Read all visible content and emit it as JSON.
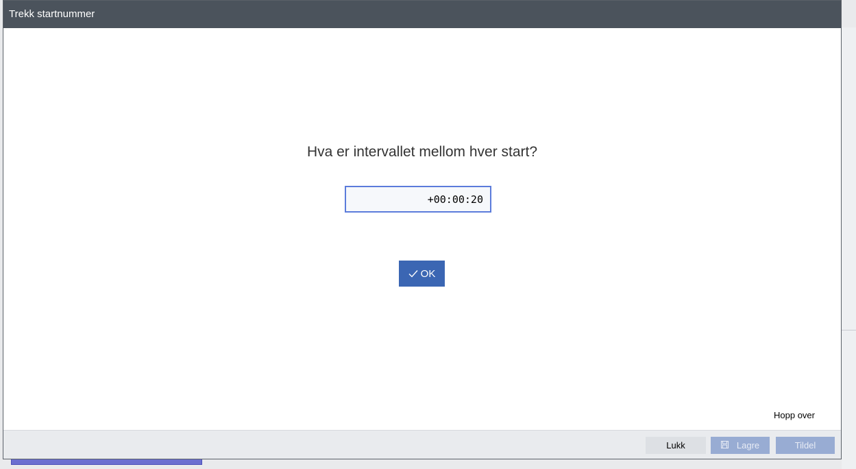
{
  "dialog": {
    "title": "Trekk startnummer",
    "question": "Hva er intervallet mellom hver start?",
    "interval_value": "+00:00:20",
    "ok_label": "OK",
    "skip_label": "Hopp over"
  },
  "footer": {
    "close_label": "Lukk",
    "save_label": "Lagre",
    "assign_label": "Tildel"
  },
  "icons": {
    "ok": "checkmark-icon",
    "save": "save-icon"
  },
  "colors": {
    "titlebar": "#4b535c",
    "accent": "#3b66b3",
    "disabled_button": "#98acd3",
    "input_border": "#5b7bdb"
  }
}
